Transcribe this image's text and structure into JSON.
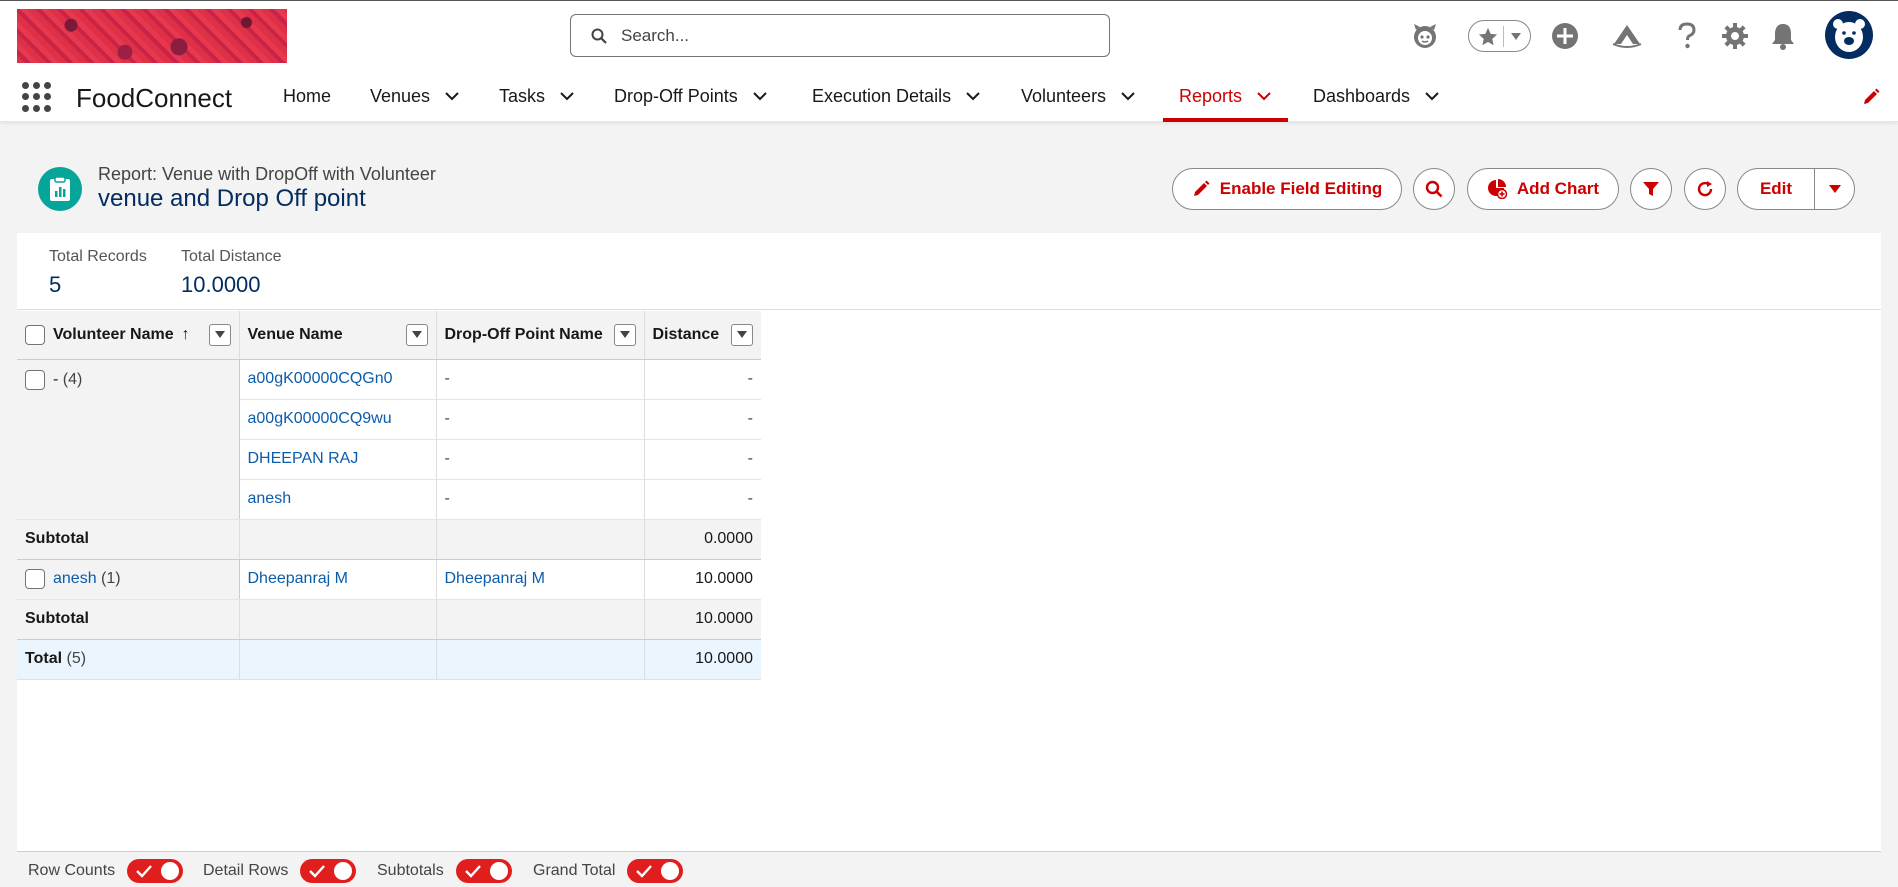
{
  "header": {
    "search_placeholder": "Search...",
    "icons": [
      "agent-icon",
      "favorites-star-icon",
      "add-icon",
      "trailhead-icon",
      "help-icon",
      "setup-gear-icon",
      "notifications-bell-icon",
      "avatar"
    ]
  },
  "nav": {
    "app_name": "FoodConnect",
    "items": [
      {
        "label": "Home",
        "has_menu": false
      },
      {
        "label": "Venues",
        "has_menu": true
      },
      {
        "label": "Tasks",
        "has_menu": true
      },
      {
        "label": "Drop-Off Points",
        "has_menu": true
      },
      {
        "label": "Execution Details",
        "has_menu": true
      },
      {
        "label": "Volunteers",
        "has_menu": true
      },
      {
        "label": "Reports",
        "has_menu": true,
        "active": true
      },
      {
        "label": "Dashboards",
        "has_menu": true
      }
    ]
  },
  "report": {
    "subtitle": "Report: Venue with DropOff with Volunteer",
    "title": "venue and Drop Off point",
    "buttons": {
      "enable_field_editing": "Enable Field Editing",
      "add_chart": "Add Chart",
      "edit": "Edit"
    }
  },
  "summary": {
    "total_records_label": "Total Records",
    "total_records_value": "5",
    "total_distance_label": "Total Distance",
    "total_distance_value": "10.0000"
  },
  "table": {
    "columns": [
      "Volunteer Name",
      "Venue Name",
      "Drop-Off Point Name",
      "Distance"
    ],
    "sort_indicator": "↑",
    "groups": [
      {
        "label": "-",
        "count": "(4)",
        "rows": [
          {
            "venue": "a00gK00000CQGn0",
            "dropoff": "-",
            "distance": "-"
          },
          {
            "venue": "a00gK00000CQ9wu",
            "dropoff": "-",
            "distance": "-"
          },
          {
            "venue": "DHEEPAN RAJ",
            "dropoff": "-",
            "distance": "-"
          },
          {
            "venue": "anesh",
            "dropoff": "-",
            "distance": "-"
          }
        ],
        "subtotal_label": "Subtotal",
        "subtotal_value": "0.0000"
      },
      {
        "label": "anesh",
        "count": "(1)",
        "rows": [
          {
            "venue": "Dheepanraj M",
            "dropoff": "Dheepanraj M",
            "distance": "10.0000"
          }
        ],
        "subtotal_label": "Subtotal",
        "subtotal_value": "10.0000"
      }
    ],
    "total_label": "Total",
    "total_count": "(5)",
    "total_value": "10.0000"
  },
  "footer": {
    "toggles": [
      {
        "label": "Row Counts",
        "on": true
      },
      {
        "label": "Detail Rows",
        "on": true
      },
      {
        "label": "Subtotals",
        "on": true
      },
      {
        "label": "Grand Total",
        "on": true
      }
    ]
  },
  "colors": {
    "brand_red": "#c00000",
    "nav_text": "#181818",
    "link": "#0b5cab",
    "report_icon": "#06a59a",
    "avatar_bg": "#032d60"
  }
}
